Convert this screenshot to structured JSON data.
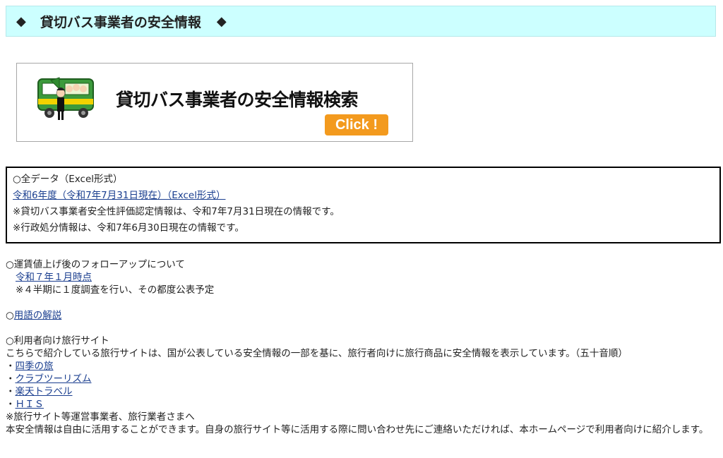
{
  "header": {
    "diamond_left": "◆",
    "title": "貸切バス事業者の安全情報",
    "diamond_right": "◆"
  },
  "banner": {
    "title": "貸切バス事業者の安全情報検索",
    "button_label": "Click !"
  },
  "all_data": {
    "heading": "○全データ（Excel形式）",
    "link_label": "令和6年度（令和7年7月31日現在）（Excel形式）",
    "note1": "※貸切バス事業者安全性評価認定情報は、令和7年7月31日現在の情報です。",
    "note2": "※行政処分情報は、令和7年6月30日現在の情報です。"
  },
  "followup": {
    "heading": "○運賃値上げ後のフォローアップについて",
    "link_label": "令和７年１月時点",
    "note": "※４半期に１度調査を行い、その都度公表予定"
  },
  "glossary": {
    "prefix": "○",
    "link_label": "用語の解説"
  },
  "travel": {
    "heading": "○利用者向け旅行サイト",
    "description": "こちらで紹介している旅行サイトは、国が公表している安全情報の一部を基に、旅行者向けに旅行商品に安全情報を表示しています。（五十音順）",
    "bullet": "・",
    "sites": [
      {
        "label": "四季の旅"
      },
      {
        "label": "クラブツーリズム"
      },
      {
        "label": "楽天トラベル"
      },
      {
        "label": "ＨＩＳ"
      }
    ],
    "operator_heading": "※旅行サイト等運営事業者、旅行業者さまへ",
    "operator_text": "本安全情報は自由に活用することができます。自身の旅行サイト等に活用する際に問い合わせ先にご連絡いただければ、本ホームページで利用者向けに紹介します。"
  }
}
